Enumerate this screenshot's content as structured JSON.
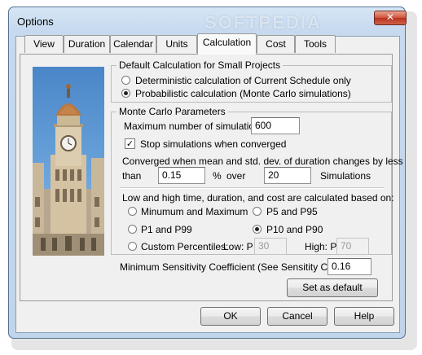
{
  "window": {
    "title": "Options",
    "watermark": "SOFTPEDIA",
    "close_glyph": "✕"
  },
  "tabs": [
    {
      "label": "View"
    },
    {
      "label": "Duration"
    },
    {
      "label": "Calendar"
    },
    {
      "label": "Units"
    },
    {
      "label": "Calculation",
      "active": true
    },
    {
      "label": "Cost"
    },
    {
      "label": "Tools"
    }
  ],
  "default_calc": {
    "legend": "Default Calculation for Small Projects",
    "deterministic": "Deterministic calculation of Current Schedule only",
    "probabilistic": "Probabilistic calculation (Monte Carlo simulations)",
    "selected": "probabilistic"
  },
  "monte_carlo": {
    "legend": "Monte Carlo Parameters",
    "max_sims_label": "Maximum number of simulations:",
    "max_sims_value": "600",
    "stop_label": "Stop simulations when converged",
    "stop_checked": true,
    "converged_text": "Converged when mean and std. dev. of duration changes by less",
    "than_label": "than",
    "than_value": "0.15",
    "percent_label": "%",
    "over_label": "over",
    "over_value": "20",
    "simulations_label": "Simulations",
    "range_text": "Low and high time, duration, and cost are calculated based on:",
    "options": {
      "min_max": "Minumum and Maximum",
      "p5_p95": "P5 and P95",
      "p1_p99": "P1 and P99",
      "p10_p90": "P10 and P90",
      "custom": "Custom Percentiles:"
    },
    "selected_option": "p10_p90",
    "low_label": "Low: P",
    "low_value": "30",
    "high_label": "High: P",
    "high_value": "70"
  },
  "sensitivity": {
    "label": "Minimum Sensitivity Coefficient (See Sensitity Charts):",
    "value": "0.16"
  },
  "buttons": {
    "set_default": "Set as default",
    "ok": "OK",
    "cancel": "Cancel",
    "help": "Help"
  },
  "icons": {
    "close": "close-icon",
    "check": "checkmark-icon"
  }
}
